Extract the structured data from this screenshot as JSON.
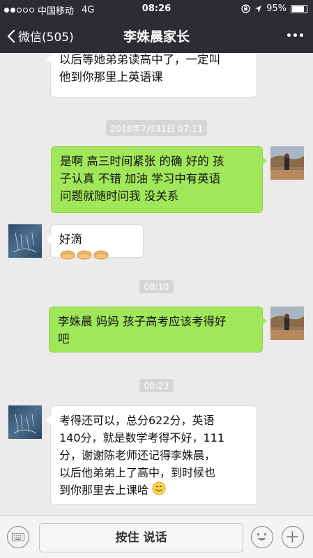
{
  "status_bar": {
    "carrier": "中国移动",
    "network": "4G",
    "time": "08:26",
    "battery": "95%",
    "battery_level": 0.95
  },
  "nav": {
    "back_label": "微信(505)",
    "title": "李姝晨家长"
  },
  "messages": [
    {
      "id": "m1",
      "side": "in",
      "lines": [
        "以后等她弟弟读高中了，一定叫",
        "他到你那里上英语课"
      ]
    },
    {
      "id": "t1",
      "timestamp": "2018年7月31日 07:11"
    },
    {
      "id": "m2",
      "side": "out",
      "lines": [
        "是啊 高三时间紧张 的确 好的  孩",
        "子认真 不错 加油 学习中有英语",
        "问题就随时问我 没关系"
      ]
    },
    {
      "id": "m3",
      "side": "in",
      "lines": [
        "好滴"
      ],
      "emoji": "handshake-emoji x3"
    },
    {
      "id": "t2",
      "timestamp": "08:10"
    },
    {
      "id": "m4",
      "side": "out",
      "lines": [
        "李姝晨 妈妈 孩子高考应该考得好",
        "吧"
      ]
    },
    {
      "id": "t3",
      "timestamp": "08:23"
    },
    {
      "id": "m5",
      "side": "in",
      "lines": [
        "考得还可以，总分622分，英语",
        "140分，就是数学考得不好，111",
        "分，谢谢陈老师还记得李姝晨，",
        "以后他弟弟上了高中，到时候也",
        "到你那里去上课哈"
      ],
      "emoji": "smile-emoji"
    }
  ],
  "input_bar": {
    "hold_to_talk": "按住 说话"
  },
  "colors": {
    "nav_bg": "#2e2c33",
    "chat_bg": "#ebebeb",
    "out_bubble": "#a1e75a",
    "in_bubble": "#ffffff"
  }
}
